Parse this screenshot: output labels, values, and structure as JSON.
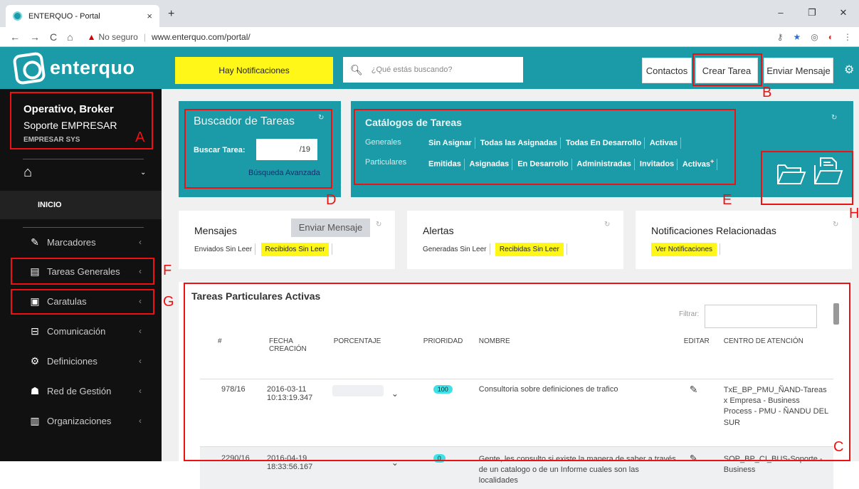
{
  "browser": {
    "tab_title": "ENTERQUO - Portal",
    "tab_close": "×",
    "new_tab": "+",
    "window_controls": [
      "–",
      "❐",
      "✕"
    ],
    "security_text": "No seguro",
    "url": "www.enterquo.com/portal/"
  },
  "header": {
    "logo_text": "enterquo",
    "notifications_button": "Hay Notificaciones",
    "search_placeholder": "¿Qué estás buscando?",
    "contacts_button": "Contactos",
    "create_task_button": "Crear Tarea",
    "send_message_button": "Enviar Mensaje"
  },
  "sidebar": {
    "user_name": "Operativo, Broker",
    "user_role": "Soporte EMPRESAR",
    "user_company": "EMPRESAR SYS",
    "home_label": "INICIO",
    "items": [
      {
        "label": "Marcadores",
        "icon": "pencil-icon"
      },
      {
        "label": "Tareas Generales",
        "icon": "document-icon"
      },
      {
        "label": "Caratulas",
        "icon": "clipboard-icon"
      },
      {
        "label": "Comunicación",
        "icon": "inbox-icon"
      },
      {
        "label": "Definiciones",
        "icon": "gear-icon"
      },
      {
        "label": "Red de Gestión",
        "icon": "users-icon"
      },
      {
        "label": "Organizaciones",
        "icon": "building-icon"
      }
    ]
  },
  "buscador": {
    "title": "Buscador de Tareas",
    "search_label": "Buscar Tarea:",
    "search_value": "/19",
    "advanced_link": "Búsqueda Avanzada"
  },
  "catalogos": {
    "title": "Catálogos de Tareas",
    "generales_label": "Generales",
    "generales_links": [
      "Sin Asignar",
      "Todas las Asignadas",
      "Todas En Desarrollo",
      "Activas"
    ],
    "particulares_label": "Particulares",
    "particulares_links": [
      "Emitidas",
      "Asignadas",
      "En Desarrollo",
      "Administradas",
      "Invitados",
      "Activas"
    ],
    "particulares_sup": "+"
  },
  "mensajes": {
    "title": "Mensajes",
    "send_button": "Enviar Mensaje",
    "sent_unread": "Enviados Sin Leer",
    "received_unread": "Recibidos Sin Leer"
  },
  "alertas": {
    "title": "Alertas",
    "generated_unread": "Generadas Sin Leer",
    "received_unread": "Recibidas Sin Leer"
  },
  "notificaciones": {
    "title": "Notificaciones Relacionadas",
    "view_button": "Ver Notificaciones"
  },
  "tareas": {
    "title": "Tareas Particulares Activas",
    "filter_label": "Filtrar:",
    "filter_value": "",
    "columns": [
      "#",
      "FECHA CREACIÓN",
      "PORCENTAJE",
      "PRIORIDAD",
      "NOMBRE",
      "EDITAR",
      "CENTRO DE ATENCIÓN"
    ],
    "rows": [
      {
        "id": "978/16",
        "date": "2016-03-11",
        "time": "10:13:19.347",
        "priority": "100",
        "name": "Consultoria sobre definiciones de trafico",
        "center": "TxE_BP_PMU_ÑAND-Tareas x Empresa - Business Process - PMU - ÑANDU DEL SUR"
      },
      {
        "id": "2290/16",
        "date": "2016-04-19",
        "time": "18:33:56.167",
        "priority": "0",
        "name": "Gente, les consulto si existe la manera de saber a través de un catalogo o de un Informe cuales son las localidades",
        "center": "SOP_BP_CI_BUS-Soporte - Business"
      }
    ]
  },
  "annotations": {
    "A": "A",
    "B": "B",
    "C": "C",
    "D": "D",
    "E": "E",
    "F": "F",
    "G": "G",
    "H": "H"
  },
  "colors": {
    "teal": "#1b9ba8",
    "yellow": "#fff717",
    "sidebar_bg": "#111111",
    "annotation_red": "#e11111"
  }
}
